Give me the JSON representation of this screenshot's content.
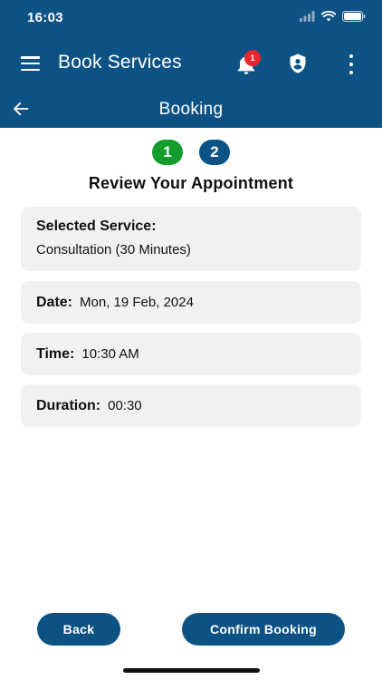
{
  "status_bar": {
    "time": "16:03"
  },
  "app_bar": {
    "title": "Book Services",
    "notification_count": "1",
    "icons": [
      "menu-icon",
      "bell-icon",
      "shield-user-icon",
      "more-vertical-icon"
    ]
  },
  "sub_header": {
    "title": "Booking",
    "back_icon": "arrow-left-icon"
  },
  "stepper": {
    "steps": [
      "1",
      "2"
    ],
    "current": 2
  },
  "review": {
    "title": "Review Your Appointment",
    "service": {
      "label": "Selected Service:",
      "value": "Consultation (30 Minutes)"
    },
    "date": {
      "label": "Date:",
      "value": "Mon, 19 Feb, 2024"
    },
    "time": {
      "label": "Time:",
      "value": "10:30 AM"
    },
    "duration": {
      "label": "Duration:",
      "value": "00:30"
    }
  },
  "actions": {
    "back_label": "Back",
    "confirm_label": "Confirm Booking"
  },
  "colors": {
    "primary": "#0d5284",
    "success": "#129d2d",
    "badge": "#e8262b",
    "card": "#f1f1f1"
  }
}
